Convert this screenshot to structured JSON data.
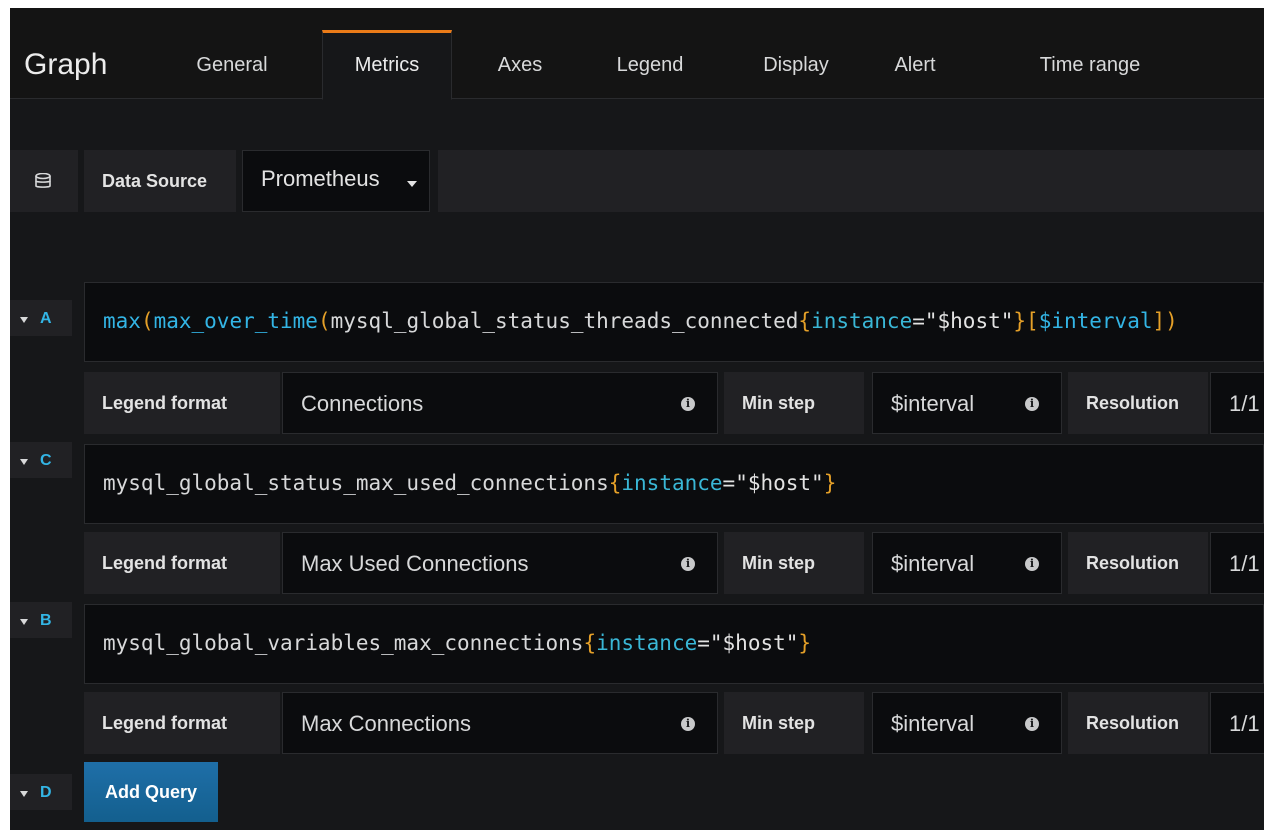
{
  "header": {
    "title": "Graph",
    "tabs": [
      {
        "label": "General"
      },
      {
        "label": "Metrics"
      },
      {
        "label": "Axes"
      },
      {
        "label": "Legend"
      },
      {
        "label": "Display"
      },
      {
        "label": "Alert"
      },
      {
        "label": "Time range"
      }
    ],
    "active_tab": "Metrics"
  },
  "datasource": {
    "label": "Data Source",
    "value": "Prometheus",
    "icon": "database-icon"
  },
  "queries": [
    {
      "letter": "A",
      "expr_parts": [
        "max",
        "(",
        "max_over_time",
        "(",
        "mysql_global_status_threads_connected",
        "{",
        "instance",
        "=\"$host\"",
        "}",
        "[",
        "$interval",
        "]",
        ")"
      ],
      "legend_label": "Legend format",
      "legend_value": "Connections",
      "min_step_label": "Min step",
      "min_step_value": "$interval",
      "resolution_label": "Resolution",
      "resolution_value": "1/1"
    },
    {
      "letter": "C",
      "expr_parts": [
        "mysql_global_status_max_used_connections",
        "{",
        "instance",
        "=\"$host\"",
        "}"
      ],
      "legend_label": "Legend format",
      "legend_value": "Max Used Connections",
      "min_step_label": "Min step",
      "min_step_value": "$interval",
      "resolution_label": "Resolution",
      "resolution_value": "1/1"
    },
    {
      "letter": "B",
      "expr_parts": [
        "mysql_global_variables_max_connections",
        "{",
        "instance",
        "=\"$host\"",
        "}"
      ],
      "legend_label": "Legend format",
      "legend_value": "Max Connections",
      "min_step_label": "Min step",
      "min_step_value": "$interval",
      "resolution_label": "Resolution",
      "resolution_value": "1/1"
    }
  ],
  "add_query": {
    "letter": "D",
    "label": "Add Query"
  },
  "colors": {
    "accent": "#eb7b18",
    "function": "#33b5e5",
    "bracket": "#e5a028",
    "button": "#135f8e"
  }
}
